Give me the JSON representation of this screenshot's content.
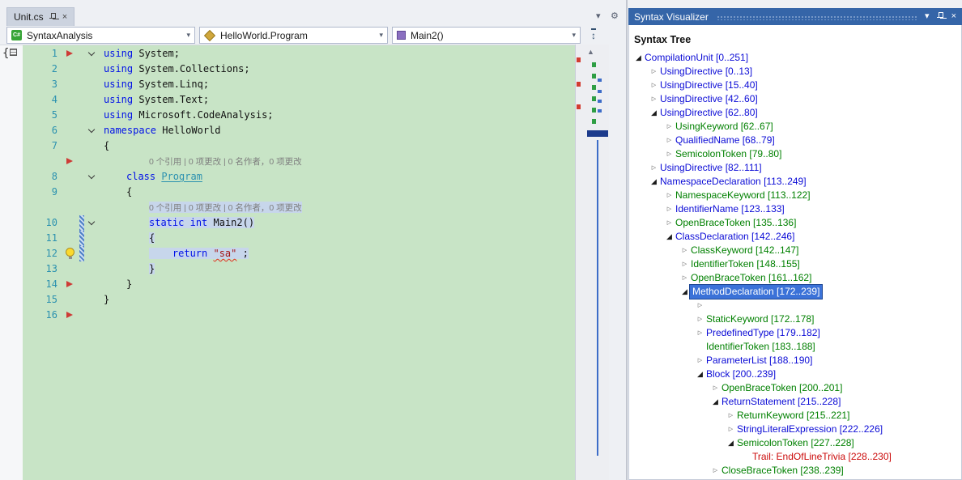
{
  "window": {
    "tab_title": "Unit.cs",
    "nav": {
      "project": "SyntaxAnalysis",
      "type": "HelloWorld.Program",
      "member": "Main2()"
    }
  },
  "icons": {
    "tab_close": "×",
    "panel_close": "×",
    "combo_chevron": "▾",
    "window_menu_chevron": "▾",
    "options_gear": "⚙",
    "split_handle": "↕",
    "scroll_up_arrow": "▲",
    "tree_collapsed": "▷",
    "tree_expanded": "◢"
  },
  "colors": {
    "panel_title_bar": "#3565A8",
    "tree_selection": "#3B72D8",
    "tree_node_blue": "#0B0BD6",
    "tree_token_green": "#008000",
    "tree_trivia_red": "#CB0A0A",
    "editor_background_highlight": "#C8E4C6",
    "method_span_highlight": "#C7D6EB",
    "keyword_blue": "#0010E8",
    "string_red": "#A31515",
    "line_number_teal": "#2B91AF",
    "codelens_gray": "#7E7E7E",
    "change_bar_blue": "#4F81C7",
    "margin_marker_red": "#CE3B36"
  },
  "editor": {
    "codelens_text": "0 个引用 | 0 项更改 | 0 名作者，0 项更改",
    "lines": [
      {
        "num": 1,
        "indent": 0,
        "chevron": true,
        "glyph": "red-arrow",
        "segments": [
          {
            "t": "using ",
            "c": "kw"
          },
          {
            "t": "System;",
            "c": "id"
          }
        ]
      },
      {
        "num": 2,
        "indent": 0,
        "segments": [
          {
            "t": "using ",
            "c": "kw"
          },
          {
            "t": "System.Collections;",
            "c": "id"
          }
        ]
      },
      {
        "num": 3,
        "indent": 0,
        "segments": [
          {
            "t": "using ",
            "c": "kw"
          },
          {
            "t": "System.Linq;",
            "c": "id"
          }
        ]
      },
      {
        "num": 4,
        "indent": 0,
        "segments": [
          {
            "t": "using ",
            "c": "kw"
          },
          {
            "t": "System.Text;",
            "c": "id"
          }
        ]
      },
      {
        "num": 5,
        "indent": 0,
        "segments": [
          {
            "t": "using ",
            "c": "kw"
          },
          {
            "t": "Microsoft.CodeAnalysis;",
            "c": "id"
          }
        ]
      },
      {
        "num": 6,
        "indent": 0,
        "chevron": true,
        "segments": [
          {
            "t": "namespace ",
            "c": "kw"
          },
          {
            "t": "HelloWorld",
            "c": "id"
          }
        ]
      },
      {
        "num": 7,
        "indent": 0,
        "segments": [
          {
            "t": "{",
            "c": "id"
          }
        ]
      },
      {
        "codelens": true,
        "indent": 2,
        "glyph": "red-arrow"
      },
      {
        "num": 8,
        "indent": 1,
        "chevron": true,
        "segments": [
          {
            "t": "class ",
            "c": "kw"
          },
          {
            "t": "Program",
            "c": "typeu"
          }
        ]
      },
      {
        "num": 9,
        "indent": 1,
        "segments": [
          {
            "t": "{",
            "c": "id"
          }
        ]
      },
      {
        "codelens": true,
        "indent": 2,
        "highlight": true
      },
      {
        "num": 10,
        "indent": 2,
        "chevron": true,
        "changebar": true,
        "highlight": true,
        "segments": [
          {
            "t": "static",
            "c": "kw"
          },
          {
            "t": " ",
            "c": "id"
          },
          {
            "t": "int",
            "c": "kw"
          },
          {
            "t": " Main2()",
            "c": "id"
          }
        ]
      },
      {
        "num": 11,
        "indent": 2,
        "changebar": true,
        "highlight": true,
        "segments": [
          {
            "t": "{",
            "c": "id"
          }
        ]
      },
      {
        "num": 12,
        "indent": 2,
        "glyph": "lightbulb",
        "changebar": true,
        "highlight": true,
        "segments": [
          {
            "t": "    ",
            "c": "id"
          },
          {
            "t": "return ",
            "c": "kw"
          },
          {
            "t": "\"sa\"",
            "c": "strerr"
          },
          {
            "t": " ;",
            "c": "id"
          }
        ]
      },
      {
        "num": 13,
        "indent": 2,
        "highlight": true,
        "segments": [
          {
            "t": "}",
            "c": "id"
          }
        ]
      },
      {
        "num": 14,
        "indent": 1,
        "glyph": "red-arrow",
        "segments": [
          {
            "t": "}",
            "c": "id"
          }
        ]
      },
      {
        "num": 15,
        "indent": 0,
        "segments": [
          {
            "t": "}",
            "c": "id"
          }
        ]
      },
      {
        "num": 16,
        "indent": 0,
        "glyph": "red-arrow",
        "segments": []
      }
    ]
  },
  "visualizer": {
    "title": "Syntax Visualizer",
    "tree_header": "Syntax Tree",
    "nodes": [
      {
        "indent": 0,
        "exp": "open",
        "kind": "node",
        "label": "CompilationUnit [0..251]"
      },
      {
        "indent": 1,
        "exp": "closed",
        "kind": "node",
        "label": "UsingDirective [0..13]"
      },
      {
        "indent": 1,
        "exp": "closed",
        "kind": "node",
        "label": "UsingDirective [15..40]"
      },
      {
        "indent": 1,
        "exp": "closed",
        "kind": "node",
        "label": "UsingDirective [42..60]"
      },
      {
        "indent": 1,
        "exp": "open",
        "kind": "node",
        "label": "UsingDirective [62..80]"
      },
      {
        "indent": 2,
        "exp": "closed",
        "kind": "token",
        "label": "UsingKeyword [62..67]"
      },
      {
        "indent": 2,
        "exp": "closed",
        "kind": "node",
        "label": "QualifiedName [68..79]"
      },
      {
        "indent": 2,
        "exp": "closed",
        "kind": "token",
        "label": "SemicolonToken [79..80]"
      },
      {
        "indent": 1,
        "exp": "closed",
        "kind": "node",
        "label": "UsingDirective [82..111]"
      },
      {
        "indent": 1,
        "exp": "open",
        "kind": "node",
        "label": "NamespaceDeclaration [113..249]"
      },
      {
        "indent": 2,
        "exp": "closed",
        "kind": "token",
        "label": "NamespaceKeyword [113..122]"
      },
      {
        "indent": 2,
        "exp": "closed",
        "kind": "node",
        "label": "IdentifierName [123..133]"
      },
      {
        "indent": 2,
        "exp": "closed",
        "kind": "token",
        "label": "OpenBraceToken [135..136]"
      },
      {
        "indent": 2,
        "exp": "open",
        "kind": "node",
        "label": "ClassDeclaration [142..246]"
      },
      {
        "indent": 3,
        "exp": "closed",
        "kind": "token",
        "label": "ClassKeyword [142..147]"
      },
      {
        "indent": 3,
        "exp": "closed",
        "kind": "token",
        "label": "IdentifierToken [148..155]"
      },
      {
        "indent": 3,
        "exp": "closed",
        "kind": "token",
        "label": "OpenBraceToken [161..162]"
      },
      {
        "indent": 3,
        "exp": "open",
        "kind": "node",
        "label": "MethodDeclaration [172..239]",
        "selected": true
      },
      {
        "indent": 4,
        "exp": "closed",
        "kind": "node",
        "label": ""
      },
      {
        "indent": 4,
        "exp": "closed",
        "kind": "token",
        "label": "StaticKeyword [172..178]"
      },
      {
        "indent": 4,
        "exp": "closed",
        "kind": "node",
        "label": "PredefinedType [179..182]"
      },
      {
        "indent": 4,
        "exp": "none",
        "kind": "token",
        "label": "IdentifierToken [183..188]"
      },
      {
        "indent": 4,
        "exp": "closed",
        "kind": "node",
        "label": "ParameterList [188..190]"
      },
      {
        "indent": 4,
        "exp": "open",
        "kind": "node",
        "label": "Block [200..239]"
      },
      {
        "indent": 5,
        "exp": "closed",
        "kind": "token",
        "label": "OpenBraceToken [200..201]"
      },
      {
        "indent": 5,
        "exp": "open",
        "kind": "node",
        "label": "ReturnStatement [215..228]"
      },
      {
        "indent": 6,
        "exp": "closed",
        "kind": "token",
        "label": "ReturnKeyword [215..221]"
      },
      {
        "indent": 6,
        "exp": "closed",
        "kind": "node",
        "label": "StringLiteralExpression [222..226]"
      },
      {
        "indent": 6,
        "exp": "open",
        "kind": "token",
        "label": "SemicolonToken [227..228]"
      },
      {
        "indent": 7,
        "exp": "none",
        "kind": "trivia",
        "label": "Trail: EndOfLineTrivia [228..230]"
      },
      {
        "indent": 5,
        "exp": "closed",
        "kind": "token",
        "label": "CloseBraceToken [238..239]"
      }
    ]
  }
}
